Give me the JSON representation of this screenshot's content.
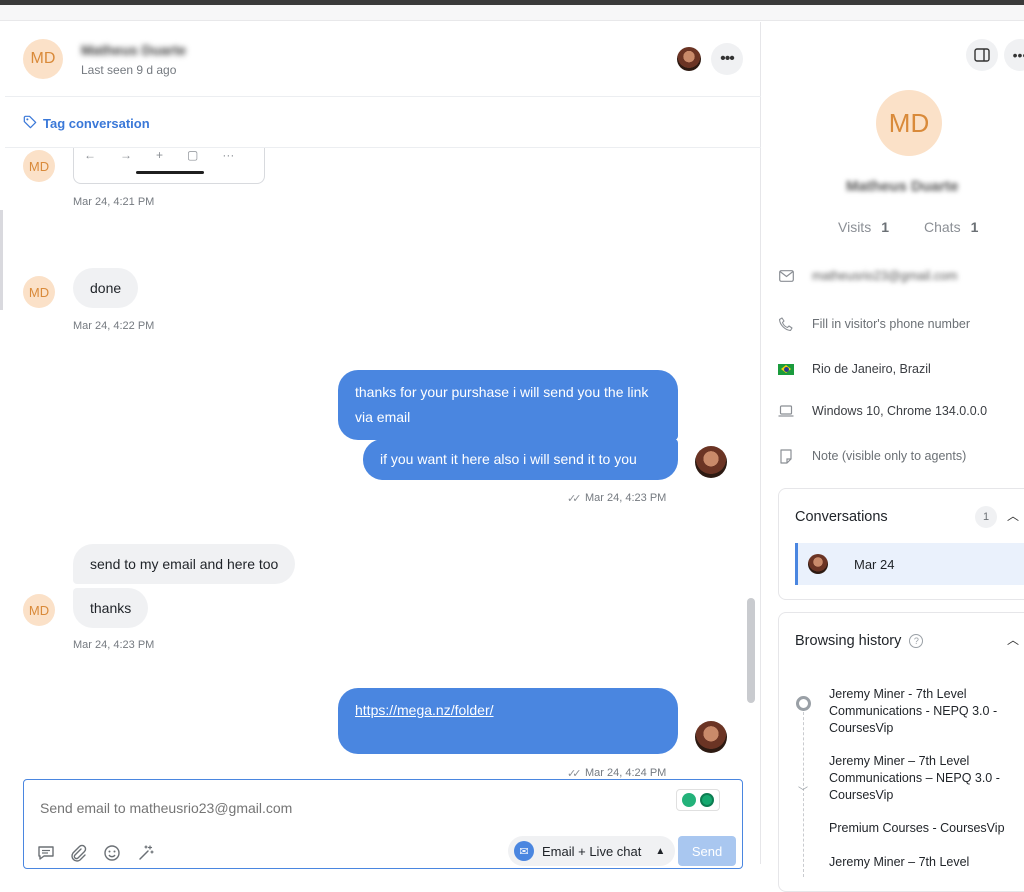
{
  "header": {
    "initials": "MD",
    "visitor_name": "Matheus Duarte",
    "last_seen": "Last seen 9 d ago",
    "more_label": "•••"
  },
  "tag": {
    "label": "Tag conversation"
  },
  "messages": {
    "time1": "Mar 24, 4:21 PM",
    "done_text": "done",
    "time2": "Mar 24, 4:22 PM",
    "out1": "thanks for your purshase i will send you the link via email",
    "out2": "if you want it here also i will send it to you",
    "time3": "Mar 24, 4:23 PM",
    "in2": "send to my email and here too",
    "in3": "thanks",
    "time4": "Mar 24, 4:23 PM",
    "link": "https://mega.nz/folder/",
    "time5": "Mar 24, 4:24 PM"
  },
  "composer": {
    "placeholder": "Send email to matheusrio23@gmail.com",
    "channel_label": "Email + Live chat",
    "send_label": "Send"
  },
  "sidebar": {
    "initials": "MD",
    "name": "Matheus Duarte",
    "visits_label": "Visits",
    "visits_count": "1",
    "chats_label": "Chats",
    "chats_count": "1",
    "email": "matheusrio23@gmail.com",
    "phone_placeholder": "Fill in visitor's phone number",
    "location": "Rio de Janeiro, Brazil",
    "system": "Windows 10, Chrome 134.0.0.0",
    "note_placeholder": "Note (visible only to agents)",
    "conversations_title": "Conversations",
    "conversations_count": "1",
    "conversation_date": "Mar 24",
    "browsing_title": "Browsing history",
    "history": [
      "Jeremy Miner - 7th Level Communications - NEPQ 3.0 - CoursesVip",
      "Jeremy Miner – 7th Level Communications – NEPQ 3.0 - CoursesVip",
      "Premium Courses - CoursesVip",
      "Jeremy Miner – 7th Level"
    ]
  },
  "colors": {
    "accent": "#4a86e0",
    "avatar_bg": "#fbe1c8",
    "avatar_text": "#d98a3a"
  }
}
